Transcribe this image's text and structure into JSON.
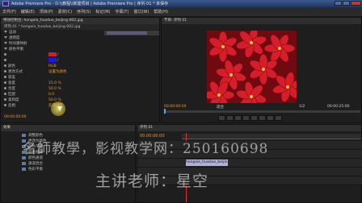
{
  "window": {
    "title": "Adobe Premiere Pro - D:\\\\教程\\\\新建项目 | Adobe Premiere Pro | 序列 01 * 未保存"
  },
  "menu": [
    "文件(F)",
    "编辑(E)",
    "项目(P)",
    "素材(C)",
    "序列(S)",
    "标记(M)",
    "字幕(T)",
    "窗口(W)",
    "帮助(H)"
  ],
  "effect_controls": {
    "tab_label": "特效控制台: hongxie_huaduo_beijing-002.jpg",
    "clip_label": "序列 01 * hongxie_huaduo_beijing-002.jpg",
    "rows": [
      {
        "label": "运动",
        "value": ""
      },
      {
        "label": "透明度",
        "value": ""
      },
      {
        "label": "时间重映射",
        "value": ""
      },
      {
        "label": "颜色平衡",
        "value": ""
      },
      {
        "label": "",
        "value": ""
      },
      {
        "label": "",
        "value": ""
      },
      {
        "label": "颜色",
        "value": "RGB"
      },
      {
        "label": "更改方式",
        "value": "设置为颜色"
      },
      {
        "label": "容差",
        "value": ""
      },
      {
        "label": "宽度",
        "value": "15.0 %"
      },
      {
        "label": "亮度",
        "value": "50.0 %"
      },
      {
        "label": "匹配",
        "value": "0.0"
      },
      {
        "label": "柔和度",
        "value": "50.0 %"
      },
      {
        "label": "反相",
        "value": "反转选区"
      }
    ],
    "colors": {
      "swatch_red": "#d81a2a",
      "swatch_blue": "#1b1bd8"
    },
    "timecode": "00:00:00:00"
  },
  "program_monitor": {
    "tab_label": "节目: 序列 01",
    "timecode_left": "00:00:00:00",
    "timecode_right": "00:00:25:00",
    "zoom": "适合",
    "fraction": "1/2",
    "image_colors": {
      "petal": "#d61e2a",
      "dark": "#6e0a10",
      "leaf": "#2f4a1f"
    }
  },
  "project_panel": {
    "tab_label": "效果",
    "items": [
      "调整颜色",
      "更改为颜色",
      "颜色平衡",
      "颜色替换",
      "颜色通道",
      "通道混合",
      "色彩平衡"
    ]
  },
  "timeline": {
    "tab_label": "序列 01",
    "timecode": "00:00:00:00",
    "clip_label": "hongxie_huaduo_beijin",
    "playhead_color": "#e03030"
  },
  "watermark": {
    "line1": "名師教學，影视教学网：250160698",
    "line2": "主讲老师：星空"
  }
}
